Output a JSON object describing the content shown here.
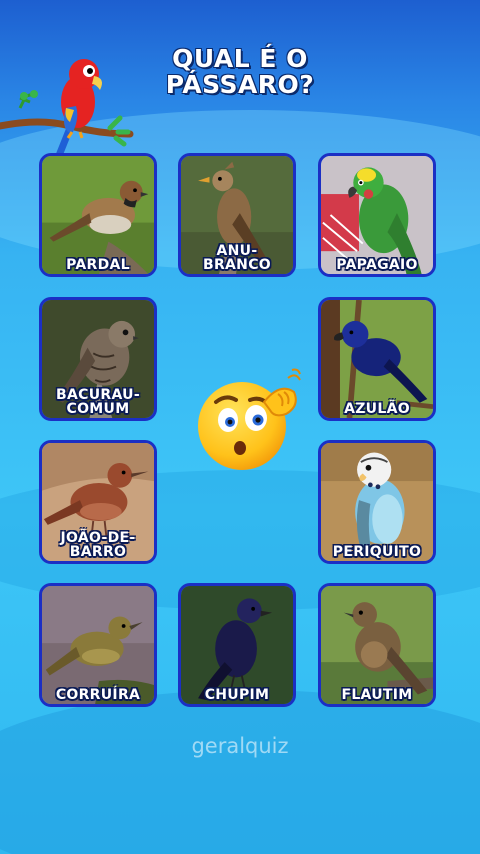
{
  "title": {
    "line1": "QUAL É O",
    "line2": "PÁSSARO?"
  },
  "cards": [
    {
      "id": "pardal",
      "label_lines": [
        "PARDAL"
      ],
      "icon": "sparrow-bird"
    },
    {
      "id": "anu-branco",
      "label_lines": [
        "ANU-",
        "BRANCO"
      ],
      "icon": "guira-cuckoo-bird"
    },
    {
      "id": "papagaio",
      "label_lines": [
        "PAPAGAIO"
      ],
      "icon": "parrot-bird"
    },
    {
      "id": "bacurau",
      "label_lines": [
        "BACURAU-",
        "COMUM"
      ],
      "icon": "nightjar-bird"
    },
    {
      "id": "azulao",
      "label_lines": [
        "AZULÃO"
      ],
      "icon": "blue-grosbeak-bird"
    },
    {
      "id": "joao-de-barro",
      "label_lines": [
        "JOÃO-DE-",
        "BARRO"
      ],
      "icon": "ovenbird-bird"
    },
    {
      "id": "periquito",
      "label_lines": [
        "PERIQUITO"
      ],
      "icon": "budgerigar-bird"
    },
    {
      "id": "corruira",
      "label_lines": [
        "CORRUÍRA"
      ],
      "icon": "wren-bird"
    },
    {
      "id": "chupim",
      "label_lines": [
        "CHUPIM"
      ],
      "icon": "cowbird-bird"
    },
    {
      "id": "flautim",
      "label_lines": [
        "FLAUTIM"
      ],
      "icon": "flautim-bird"
    }
  ],
  "watermark": "geralquiz",
  "colors": {
    "card_border": "#1b2fc4",
    "background": "#3ec6f7",
    "title_outline": "#0b2a6b"
  }
}
